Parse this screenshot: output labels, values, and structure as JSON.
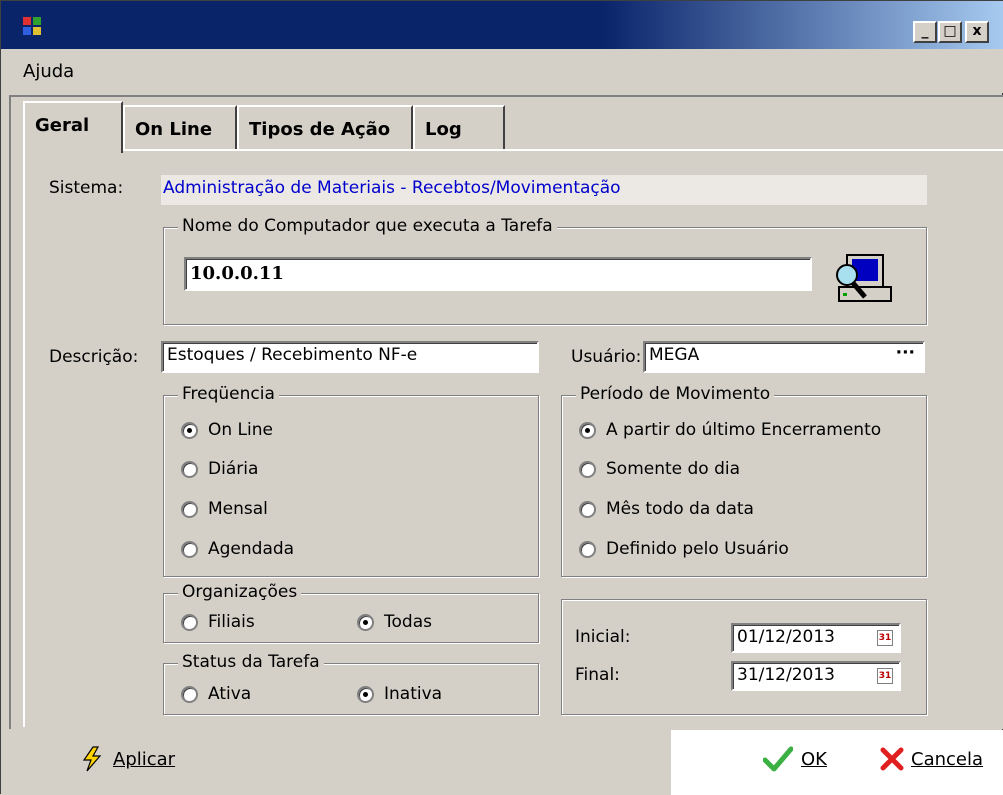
{
  "window": {
    "title": "",
    "controls": {
      "minimize": "_",
      "maximize": "□",
      "close": "x"
    }
  },
  "menu": {
    "items": [
      "Ajuda"
    ]
  },
  "tabs": [
    "Geral",
    "On Line",
    "Tipos de Ação",
    "Log"
  ],
  "geral": {
    "sistema_label": "Sistema:",
    "sistema_value": "Administração de Materiais - Recebtos/Movimentação",
    "computer_group_title": "Nome do Computador que executa a Tarefa",
    "computer_value": "10.0.0.11",
    "descricao_label": "Descrição:",
    "descricao_value": "Estoques / Recebimento NF-e",
    "usuario_label": "Usuário:",
    "usuario_value": "MEGA",
    "usuario_button": "···",
    "frequencia": {
      "title": "Freqüencia",
      "options": [
        "On Line",
        "Diária",
        "Mensal",
        "Agendada"
      ],
      "selected": "On Line"
    },
    "periodo": {
      "title": "Período de Movimento",
      "options": [
        "A partir do último Encerramento",
        "Somente do dia",
        "Mês todo da data",
        "Definido pelo Usuário"
      ],
      "selected": "A partir do último Encerramento"
    },
    "organizacoes": {
      "title": "Organizações",
      "options": [
        "Filiais",
        "Todas"
      ],
      "selected": "Todas"
    },
    "status": {
      "title": "Status da Tarefa",
      "options": [
        "Ativa",
        "Inativa"
      ],
      "selected": "Inativa"
    },
    "datas": {
      "inicial_label": "Inicial:",
      "inicial_value": "01/12/2013",
      "final_label": "Final:",
      "final_value": "31/12/2013",
      "calendar_glyph": "31"
    }
  },
  "buttons": {
    "aplicar": "Aplicar",
    "ok": "OK",
    "cancela": "Cancela"
  },
  "colors": {
    "title_bar": "#0a246a",
    "link_text": "#0000cc",
    "ok_check": "#3cb043",
    "cancel_x": "#e02020"
  }
}
